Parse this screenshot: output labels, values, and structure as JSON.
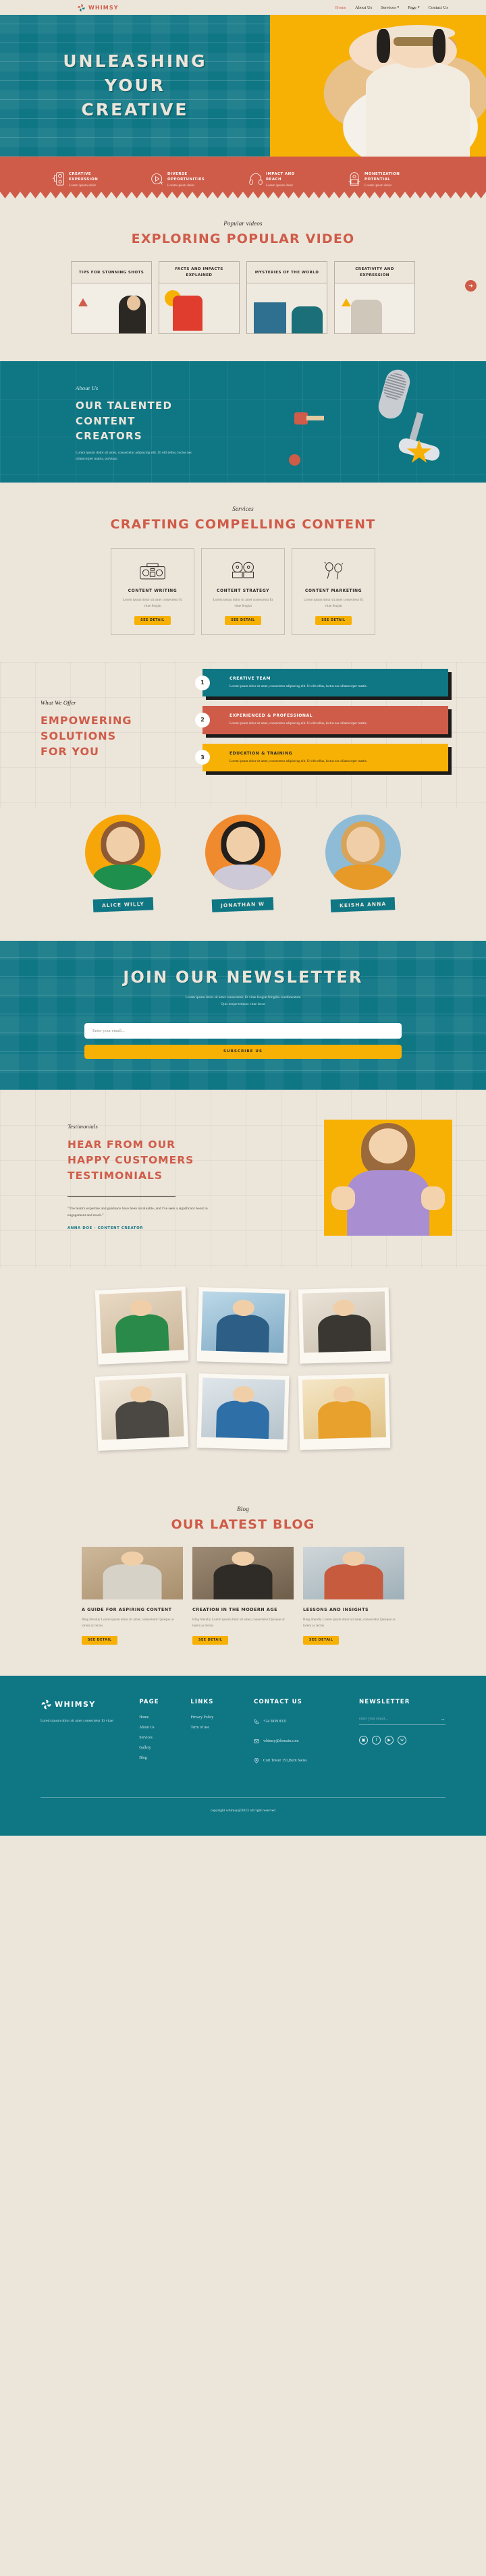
{
  "brand": {
    "name": "WHIMSY",
    "logo_icon": "pinwheel-logo-icon"
  },
  "nav": [
    {
      "label": "Home",
      "active": true
    },
    {
      "label": "About Us",
      "active": false
    },
    {
      "label": "Services",
      "active": false,
      "caret": "▾"
    },
    {
      "label": "Page",
      "active": false,
      "caret": "▾"
    },
    {
      "label": "Contact Us",
      "active": false
    }
  ],
  "hero": {
    "title_line1": "UNLEASHING",
    "title_line2": "YOUR",
    "title_line3": "CREATIVE"
  },
  "features": [
    {
      "title_l1": "CREATIVE",
      "title_l2": "EXPRESSION",
      "sub": "Lorem ipsum dolor",
      "icon": "music-player-icon"
    },
    {
      "title_l1": "DIVERSE",
      "title_l2": "OPPORTUNITIES",
      "sub": "Lorem ipsum dolor",
      "icon": "play-button-icon"
    },
    {
      "title_l1": "IMPACT AND",
      "title_l2": "REACH",
      "sub": "Lorem ipsum dolor",
      "icon": "headphones-icon"
    },
    {
      "title_l1": "MONETIZATION",
      "title_l2": "POTENTIAL",
      "sub": "Lorem ipsum dolor",
      "icon": "jukebox-icon"
    }
  ],
  "videos": {
    "eyebrow": "Popular videos",
    "heading": "EXPLORING POPULAR VIDEO",
    "next_icon": "arrow-right-icon",
    "cards": [
      {
        "title": "TIPS FOR STUNNING SHOTS"
      },
      {
        "title": "FACTS AND IMPACTS EXPLAINED"
      },
      {
        "title": "MYSTERIES OF THE WORLD"
      },
      {
        "title": "CREATIVITY AND EXPRESSION"
      }
    ]
  },
  "about": {
    "eyebrow": "About Us",
    "heading_l1": "OUR TALENTED",
    "heading_l2": "CONTENT CREATORS",
    "body": "Lorem ipsum dolor sit amet, consectetur adipiscing elit. Ut elit tellus, luctus nec ullamcorper mattis, pulvinar."
  },
  "services": {
    "eyebrow": "Services",
    "heading": "CRAFTING COMPELLING CONTENT",
    "cards": [
      {
        "title": "CONTENT WRITING",
        "body": "Lorem ipsum dolor sit amet consectetur Et vitae feugiat",
        "cta": "See Detail",
        "icon": "boombox-icon"
      },
      {
        "title": "CONTENT STRATEGY",
        "body": "Lorem ipsum dolor sit amet consectetur Et vitae feugiat",
        "cta": "See Detail",
        "icon": "tape-reel-icon"
      },
      {
        "title": "CONTENT MARKETING",
        "body": "Lorem ipsum dolor sit amet consectetur Et vitae feugiat",
        "cta": "See Detail",
        "icon": "maracas-icon"
      }
    ]
  },
  "offers": {
    "eyebrow": "What We Offer",
    "heading_l1": "EMPOWERING",
    "heading_l2": "SOLUTIONS",
    "heading_l3": "FOR YOU",
    "items": [
      {
        "num": "1",
        "title": "CREATIVE TEAM",
        "body": "Lorem ipsum dolor sit amet, consectetur adipiscing elit. Ut elit tellus, luctus nec ullamcorper mattis."
      },
      {
        "num": "2",
        "title": "EXPERIENCED & PROFESSIONAL",
        "body": "Lorem ipsum dolor sit amet, consectetur adipiscing elit. Ut elit tellus, luctus nec ullamcorper mattis."
      },
      {
        "num": "3",
        "title": "EDUCATION & TRAINING",
        "body": "Lorem ipsum dolor sit amet, consectetur adipiscing elit. Ut elit tellus, luctus nec ullamcorper mattis."
      }
    ]
  },
  "team": [
    {
      "name": "ALICE WILLY"
    },
    {
      "name": "JONATHAN W"
    },
    {
      "name": "KEISHA ANNA"
    }
  ],
  "newsletter": {
    "heading": "JOIN OUR NEWSLETTER",
    "body_l1": "Lorem ipsum dolor sit amet consectetur. Et vitae feugiat fringilla condimentum",
    "body_l2": "Quis neque tempus vitae lacus",
    "placeholder": "Enter your email...",
    "value": "",
    "button": "SUBSCRIBE US"
  },
  "testimonials": {
    "eyebrow": "Testimonials",
    "heading_l1": "HEAR FROM OUR",
    "heading_l2": "HAPPY CUSTOMERS",
    "heading_l3": "TESTIMONIALS",
    "quote": "\"The team's expertise and guidance have been invaluable, and I've seen a significant boost in engagement and reach.\"",
    "author": "ANNA DOE - CONTENT CREATOR"
  },
  "blog": {
    "eyebrow": "Blog",
    "heading": "OUR LATEST BLOG",
    "cards": [
      {
        "title": "A GUIDE FOR ASPIRING CONTENT",
        "body": "Blog literally Lorem ipsum dolor sit amet, consectetur Quisque ac lorem ac lectus",
        "cta": "See Detail"
      },
      {
        "title": "CREATION IN THE MODERN AGE",
        "body": "Blog literally Lorem ipsum dolor sit amet, consectetur Quisque ac lorem ac lectus",
        "cta": "See Detail"
      },
      {
        "title": "LESSONS AND INSIGHTS",
        "body": "Blog literally Lorem ipsum dolor sit amet, consectetur Quisque ac lorem ac lectus",
        "cta": "See Detail"
      }
    ]
  },
  "footer": {
    "brand": "WHIMSY",
    "about": "Lorem ipsum dolor sit amet consectetur Et vitae",
    "page_title": "PAGE",
    "page_links": [
      "Home",
      "About Us",
      "Services",
      "Gallery",
      "Blog"
    ],
    "links_title": "LINKS",
    "links": [
      "Privacy Policy",
      "Term of use"
    ],
    "contact_title": "CONTACT US",
    "contact": [
      {
        "icon": "phone-icon",
        "text": "+24 3839 8321"
      },
      {
        "icon": "mail-icon",
        "text": "whimsy@domain.com"
      },
      {
        "icon": "location-pin-icon",
        "text": "Cort Tower 151,Burn Swiss"
      }
    ],
    "newsletter_title": "NEWSLETTER",
    "newsletter_placeholder": "enter your email...",
    "newsletter_value": "",
    "arrow_icon": "arrow-right-icon",
    "socials": [
      "instagram-icon",
      "facebook-icon",
      "youtube-icon",
      "twitter-icon"
    ],
    "copyright": "copyright whimsy@2023 all right reserved"
  },
  "colors": {
    "teal": "#0f7684",
    "red": "#cf5c49",
    "yellow": "#f7b104",
    "cream": "#ece5da",
    "ink": "#2e2b28"
  }
}
